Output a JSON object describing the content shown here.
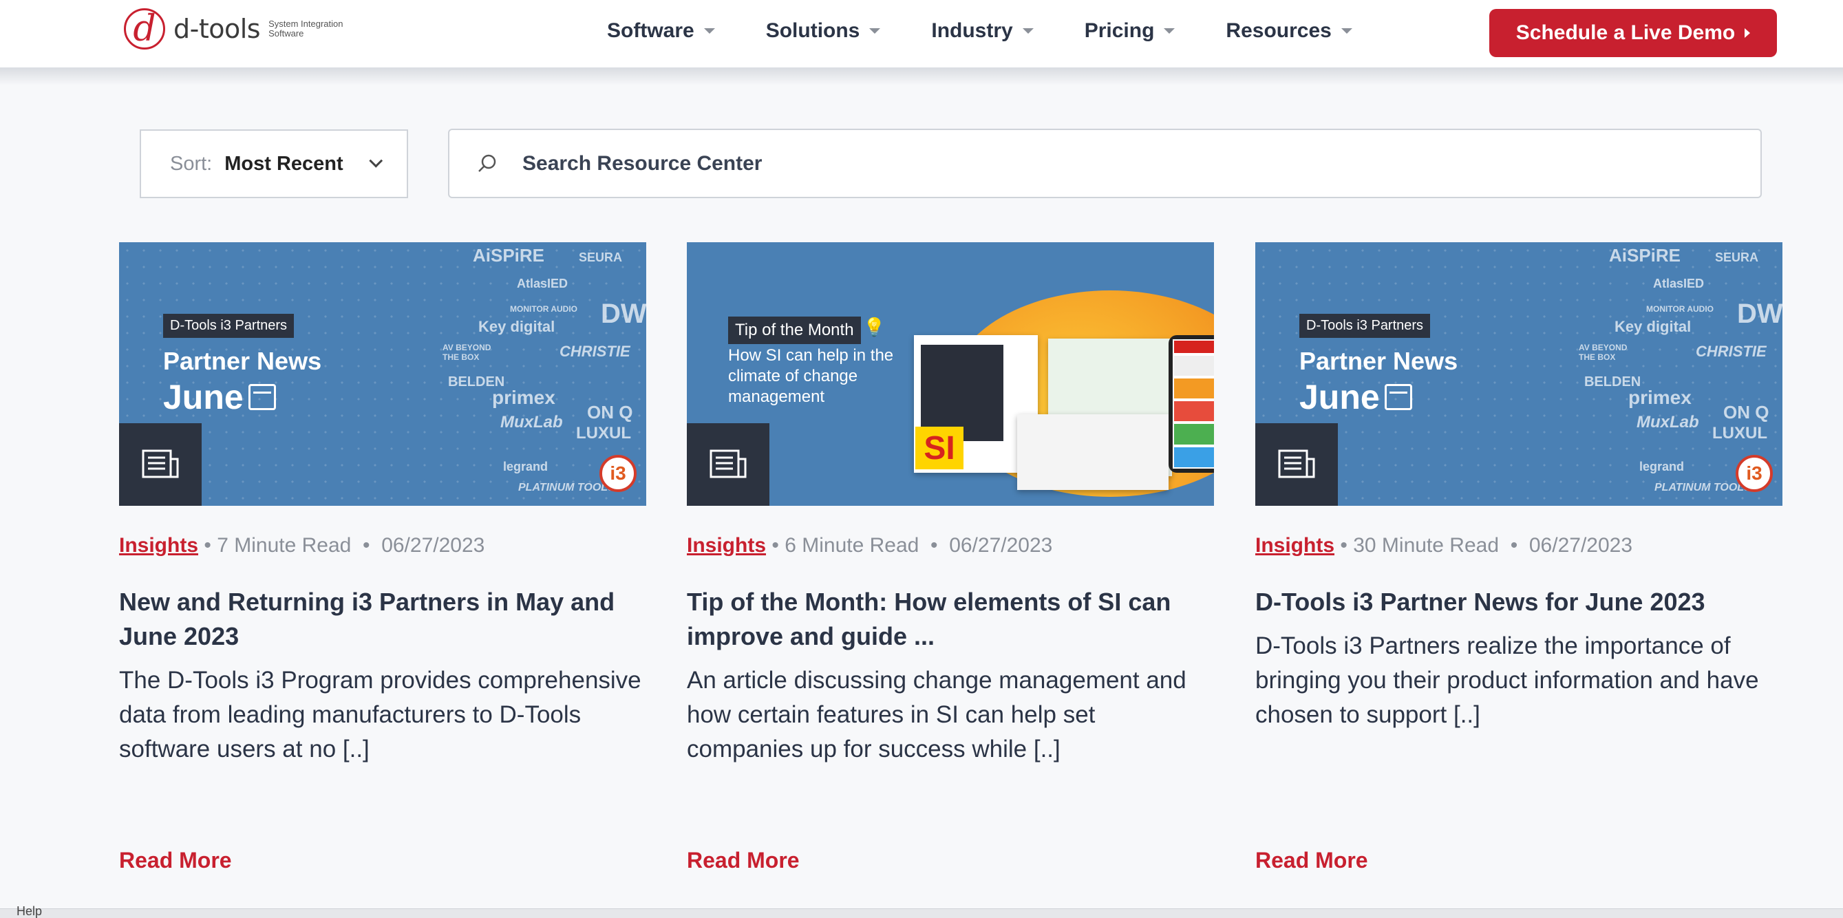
{
  "nav": {
    "logo_name": "d-tools",
    "logo_tagline": "System Integration Software",
    "menu": [
      {
        "label": "Software"
      },
      {
        "label": "Solutions"
      },
      {
        "label": "Industry"
      },
      {
        "label": "Pricing"
      },
      {
        "label": "Resources"
      }
    ],
    "cta": "Schedule a Live Demo"
  },
  "filters": {
    "sort_label": "Sort:",
    "sort_value": "Most Recent",
    "search_placeholder": "Search Resource Center"
  },
  "cards": [
    {
      "image": {
        "tag": "D-Tools i3 Partners",
        "line1": "Partner News",
        "line2": "June"
      },
      "category": "Insights",
      "read_time": "7 Minute Read",
      "date": "06/27/2023",
      "title": "New and Returning i3 Partners in May and June 2023",
      "excerpt": "The D-Tools i3 Program provides comprehensive data from leading manufacturers to D-Tools software users at no [..]",
      "read_more": "Read More"
    },
    {
      "image": {
        "tag": "Tip of the Month",
        "text": "How SI can help in the climate of change management",
        "logo": "SI"
      },
      "category": "Insights",
      "read_time": "6 Minute Read",
      "date": "06/27/2023",
      "title": "Tip of the Month: How elements of SI can improve and guide ...",
      "excerpt": "An article discussing change management and how certain features in SI can help set companies up for success while [..]",
      "read_more": "Read More"
    },
    {
      "image": {
        "tag": "D-Tools i3 Partners",
        "line1": "Partner News",
        "line2": "June"
      },
      "category": "Insights",
      "read_time": "30 Minute Read",
      "date": "06/27/2023",
      "title": "D-Tools i3 Partner News for June 2023",
      "excerpt": "D-Tools i3 Partners realize the importance of bringing you their product information and have chosen to support [..]",
      "read_more": "Read More"
    }
  ],
  "brands": [
    "AiSPiRE",
    "SEURA",
    "AtlasIED",
    "MONITOR AUDIO",
    "Key digital",
    "DW",
    "AV BEYOND THE BOX",
    "CHRISTIE",
    "BELDEN",
    "primex",
    "ON Q",
    "MuxLab",
    "LUXUL",
    "legrand",
    "PLATINUM TOOLS"
  ],
  "footer": {
    "help": "Help"
  },
  "colors": {
    "accent": "#c8202f",
    "card_image_bg": "#4a80b4",
    "text": "#2b3446"
  }
}
